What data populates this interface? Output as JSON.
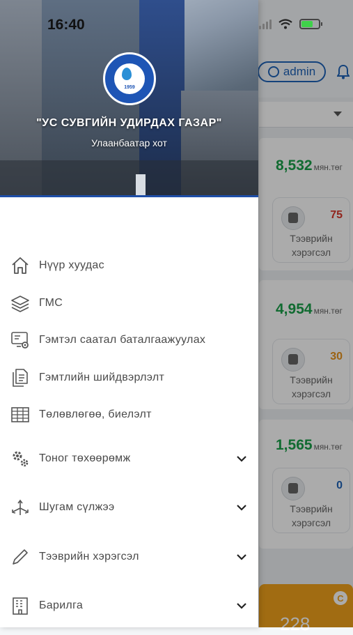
{
  "status_bar": {
    "time": "16:40"
  },
  "background": {
    "user_label": "admin",
    "cards": [
      {
        "amount": "8,532",
        "unit": "мян.төг",
        "vehicle_count": "75",
        "vehicle_count_color": "#d9382c",
        "vehicle_label": "Тээврийн хэрэгсэл"
      },
      {
        "amount": "4,954",
        "unit": "мян.төг",
        "vehicle_count": "30",
        "vehicle_count_color": "#e8931c",
        "vehicle_label": "Тээврийн хэрэгсэл"
      },
      {
        "amount": "1,565",
        "unit": "мян.төг",
        "vehicle_count": "0",
        "vehicle_count_color": "#1e63b8",
        "vehicle_label": "Тээврийн хэрэгсэл"
      }
    ],
    "bottom_card_value": "228",
    "bottom_card_badge": "C"
  },
  "drawer": {
    "org_name": "\"УС СУВГИЙН УДИРДАХ ГАЗАР\"",
    "org_city": "Улаанбаатар хот",
    "logo_year": "1959",
    "menu": [
      {
        "label": "Нүүр хуудас",
        "icon": "home-icon"
      },
      {
        "label": "ГМС",
        "icon": "layers-icon"
      },
      {
        "label": "Гэмтэл саатал баталгаажуулах",
        "icon": "monitor-gear-icon"
      },
      {
        "label": "Гэмтлийн шийдвэрлэлт",
        "icon": "documents-icon"
      },
      {
        "label": "Төлөвлөгөө, биелэлт",
        "icon": "table-icon"
      },
      {
        "label": "Тоног төхөөрөмж",
        "icon": "gears-icon",
        "expandable": true
      },
      {
        "label": "Шугам сүлжээ",
        "icon": "network-icon",
        "expandable": true
      },
      {
        "label": "Тээврийн хэрэгсэл",
        "icon": "pencil-icon",
        "expandable": true
      },
      {
        "label": "Барилга",
        "icon": "building-icon",
        "expandable": true
      }
    ]
  },
  "colors": {
    "accent": "#1e63b8",
    "amount_green": "#1aa04a"
  }
}
